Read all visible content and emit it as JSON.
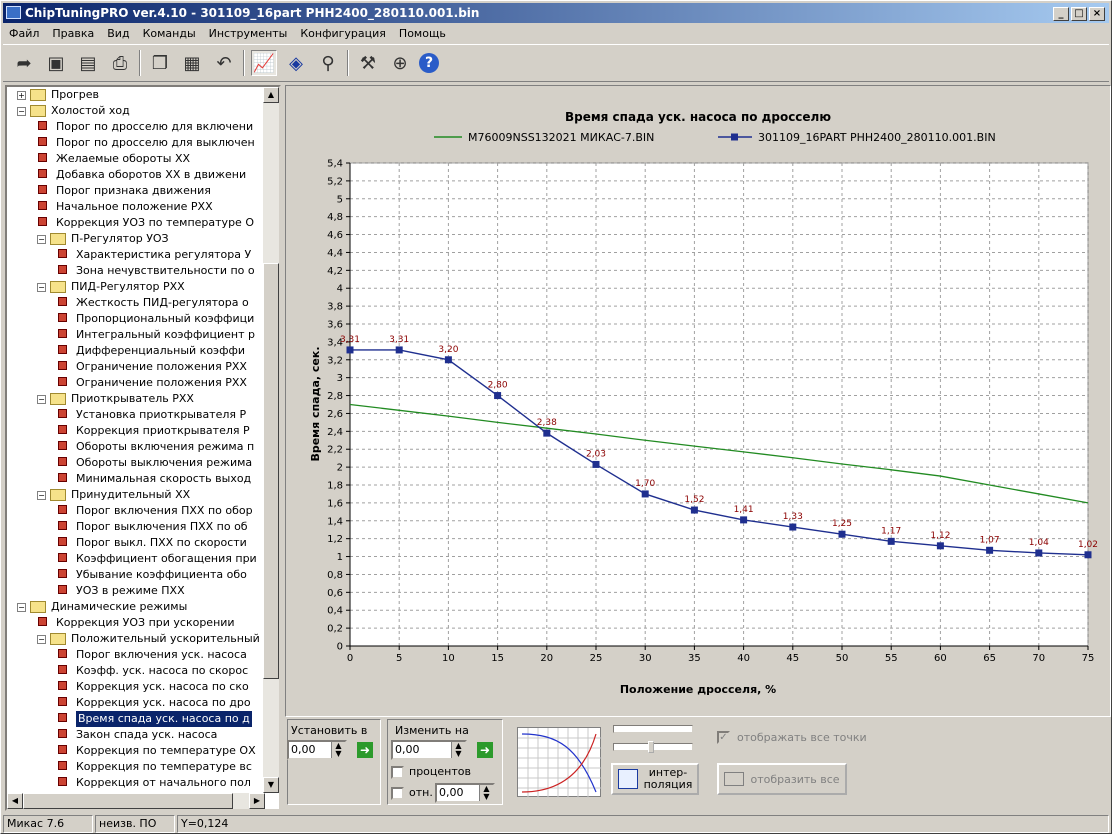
{
  "window": {
    "title": "ChipTuningPRO ver.4.10 - 301109_16part PHH2400_280110.001.bin"
  },
  "menu": [
    "Файл",
    "Правка",
    "Вид",
    "Команды",
    "Инструменты",
    "Конфигурация",
    "Помощь"
  ],
  "toolbar_icons": [
    "open-icon",
    "save-icon",
    "save-as-icon",
    "print-icon",
    "copy-icon",
    "paste-icon",
    "undo-icon",
    "chart-view-icon",
    "info-icon",
    "search-icon",
    "tools-icon",
    "network-icon",
    "help-icon"
  ],
  "tree": [
    {
      "level": 1,
      "type": "folder",
      "expanded": false,
      "label": "Прогрев"
    },
    {
      "level": 1,
      "type": "folder",
      "expanded": true,
      "label": "Холостой ход"
    },
    {
      "level": 2,
      "type": "map",
      "label": "Порог по дросселю для включени"
    },
    {
      "level": 2,
      "type": "map",
      "label": "Порог по дросселю для выключен"
    },
    {
      "level": 2,
      "type": "map",
      "label": "Желаемые обороты ХХ"
    },
    {
      "level": 2,
      "type": "map",
      "label": "Добавка оборотов ХХ в движени"
    },
    {
      "level": 2,
      "type": "map",
      "label": "Порог признака движения"
    },
    {
      "level": 2,
      "type": "map",
      "label": "Начальное положение РХХ"
    },
    {
      "level": 2,
      "type": "map",
      "label": "Коррекция УОЗ по температуре О"
    },
    {
      "level": 2,
      "type": "folder",
      "expanded": true,
      "label": "П-Регулятор УОЗ"
    },
    {
      "level": 3,
      "type": "map",
      "label": "Характеристика регулятора У"
    },
    {
      "level": 3,
      "type": "map",
      "label": "Зона нечувствительности по о"
    },
    {
      "level": 2,
      "type": "folder",
      "expanded": true,
      "label": "ПИД-Регулятор РХХ"
    },
    {
      "level": 3,
      "type": "map",
      "label": "Жесткость ПИД-регулятора о"
    },
    {
      "level": 3,
      "type": "map",
      "label": "Пропорциональный коэффици"
    },
    {
      "level": 3,
      "type": "map",
      "label": "Интегральный коэффициент р"
    },
    {
      "level": 3,
      "type": "map",
      "label": "Дифференциальный коэффи"
    },
    {
      "level": 3,
      "type": "map",
      "label": "Ограничение положения РХХ"
    },
    {
      "level": 3,
      "type": "map",
      "label": "Ограничение положения РХХ"
    },
    {
      "level": 2,
      "type": "folder",
      "expanded": true,
      "label": "Приоткрыватель РХХ"
    },
    {
      "level": 3,
      "type": "map",
      "label": "Установка приоткрывателя Р"
    },
    {
      "level": 3,
      "type": "map",
      "label": "Коррекция приоткрывателя Р"
    },
    {
      "level": 3,
      "type": "map",
      "label": "Обороты включения режима п"
    },
    {
      "level": 3,
      "type": "map",
      "label": "Обороты выключения режима"
    },
    {
      "level": 3,
      "type": "map",
      "label": "Минимальная скорость выход"
    },
    {
      "level": 2,
      "type": "folder",
      "expanded": true,
      "label": "Принудительный ХХ"
    },
    {
      "level": 3,
      "type": "map",
      "label": "Порог включения ПХХ по обор"
    },
    {
      "level": 3,
      "type": "map",
      "label": "Порог выключения ПХХ по об"
    },
    {
      "level": 3,
      "type": "map",
      "label": "Порог выкл. ПХХ по скорости"
    },
    {
      "level": 3,
      "type": "map",
      "label": "Коэффициент обогащения при"
    },
    {
      "level": 3,
      "type": "map",
      "label": "Убывание коэффициента обо"
    },
    {
      "level": 3,
      "type": "map",
      "label": "УОЗ в режиме ПХХ"
    },
    {
      "level": 1,
      "type": "folder",
      "expanded": true,
      "label": "Динамические режимы"
    },
    {
      "level": 2,
      "type": "map",
      "label": "Коррекция УОЗ при ускорении"
    },
    {
      "level": 2,
      "type": "folder",
      "expanded": true,
      "label": "Положительный ускорительный н"
    },
    {
      "level": 3,
      "type": "map",
      "label": "Порог включения уск. насоса"
    },
    {
      "level": 3,
      "type": "map",
      "label": "Коэфф. уск. насоса по скорос"
    },
    {
      "level": 3,
      "type": "map",
      "label": "Коррекция уск. насоса по ско"
    },
    {
      "level": 3,
      "type": "map",
      "label": "Коррекция уск. насоса по дро"
    },
    {
      "level": 3,
      "type": "map",
      "label": "Время спада уск. насоса по д",
      "selected": true
    },
    {
      "level": 3,
      "type": "map",
      "label": "Закон спада уск. насоса"
    },
    {
      "level": 3,
      "type": "map",
      "label": "Коррекция по температуре ОХ"
    },
    {
      "level": 3,
      "type": "map",
      "label": "Коррекция по температуре вс"
    },
    {
      "level": 3,
      "type": "map",
      "label": "Коррекция от начального пол"
    }
  ],
  "chart_data": {
    "type": "line",
    "title": "Время спада уск. насоса по дросселю",
    "xlabel": "Положение дросселя, %",
    "ylabel": "Время спада, сек.",
    "x": [
      0,
      5,
      10,
      15,
      20,
      25,
      30,
      35,
      40,
      45,
      50,
      55,
      60,
      65,
      70,
      75
    ],
    "xlim": [
      0,
      75
    ],
    "ylim": [
      0,
      5.4
    ],
    "xticks": [
      "0",
      "5",
      "10",
      "15",
      "20",
      "25",
      "30",
      "35",
      "40",
      "45",
      "50",
      "55",
      "60",
      "65",
      "70",
      "75"
    ],
    "yticks": [
      "0",
      "0,2",
      "0,4",
      "0,6",
      "0,8",
      "1",
      "1,2",
      "1,4",
      "1,6",
      "1,8",
      "2",
      "2,2",
      "2,4",
      "2,6",
      "2,8",
      "3",
      "3,2",
      "3,4",
      "3,6",
      "3,8",
      "4",
      "4,2",
      "4,4",
      "4,6",
      "4,8",
      "5",
      "5,2",
      "5,4"
    ],
    "grid": true,
    "legend_position": "top",
    "series": [
      {
        "name": "M76009NSS132021 МИКАС-7.BIN",
        "color": "#228b22",
        "marker": "none",
        "values": [
          2.7,
          2.635,
          2.57,
          2.5,
          2.435,
          2.37,
          2.3,
          2.235,
          2.17,
          2.105,
          2.035,
          1.97,
          1.9,
          1.8,
          1.7,
          1.6
        ]
      },
      {
        "name": "301109_16PART PHH2400_280110.001.BIN",
        "color": "#1f2f8f",
        "marker": "square",
        "values": [
          3.31,
          3.31,
          3.2,
          2.8,
          2.38,
          2.03,
          1.7,
          1.52,
          1.41,
          1.33,
          1.25,
          1.17,
          1.12,
          1.07,
          1.04,
          1.02
        ],
        "labels": [
          "3,31",
          "3,31",
          "3,20",
          "2,80",
          "2,38",
          "2,03",
          "1,70",
          "1,52",
          "1,41",
          "1,33",
          "1,25",
          "1,17",
          "1,12",
          "1,07",
          "1,04",
          "1,02"
        ]
      }
    ]
  },
  "controls": {
    "set_label": "Установить в",
    "set_value": "0,00",
    "change_label": "Изменить на",
    "change_value": "0,00",
    "percent_label": "процентов",
    "relative_label": "отн.",
    "relative_value": "0,00",
    "interp_label": "интер-\nполяция",
    "show_points_label": "отображать все точки",
    "show_all_label": "отобразить все"
  },
  "status": {
    "version": "Микас 7.6",
    "ecu": "неизв. ПО",
    "y": "Y=0,124"
  }
}
